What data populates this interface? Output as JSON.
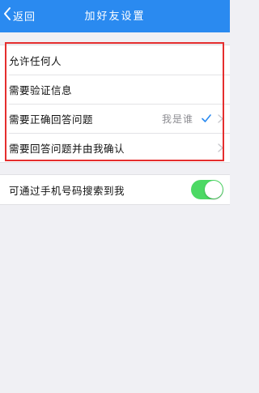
{
  "navbar": {
    "back_label": "返回",
    "title": "加好友设置"
  },
  "verify_options": [
    {
      "label": "允许任何人"
    },
    {
      "label": "需要验证信息"
    },
    {
      "label": "需要正确回答问题",
      "answer": "我是谁",
      "selected": true
    },
    {
      "label": "需要回答问题并由我确认"
    }
  ],
  "phone_search": {
    "label": "可通过手机号码搜索到我",
    "enabled": true
  },
  "colors": {
    "navbar": "#2a8af0",
    "accent": "#2a8af0",
    "toggle_on": "#4cd964",
    "highlight": "#e52e2e"
  },
  "icons": {
    "back": "chevron-left-icon",
    "selected": "checkmark-icon",
    "disclosure": "chevron-right-icon"
  }
}
